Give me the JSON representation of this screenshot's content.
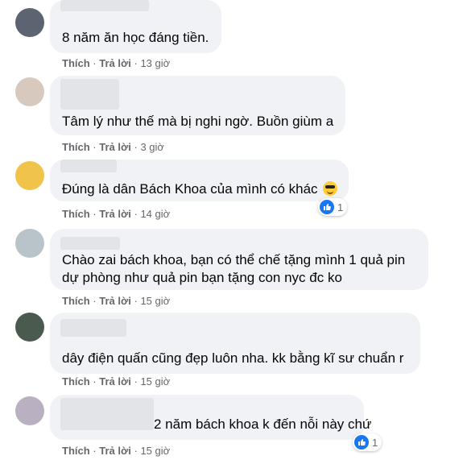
{
  "comments": [
    {
      "text_lines": [
        "8 năm ăn học đáng tiền."
      ],
      "like": "Thích",
      "reply": "Trả lời",
      "time": "13 giờ"
    },
    {
      "text_lines": [
        "Tâm lý như thế mà bị nghi ngờ. Buồn giùm a"
      ],
      "like": "Thích",
      "reply": "Trả lời",
      "time": "3 giờ"
    },
    {
      "text_lines": [
        "Đúng là dân Bách Khoa của mình có khác"
      ],
      "emoji": "sunglasses-emoji",
      "like": "Thích",
      "reply": "Trả lời",
      "time": "14 giờ",
      "reaction_count": "1"
    },
    {
      "text_lines": [
        "Chào zai bách khoa, bạn có thể chế tặng mình 1 quả pin",
        "dự phòng như quả pin bạn tặng con nyc đc ko"
      ],
      "like": "Thích",
      "reply": "Trả lời",
      "time": "15 giờ"
    },
    {
      "text_lines": [
        "dây điện quấn cũng đẹp luôn nha. kk bằng kĩ sư chuẩn r"
      ],
      "like": "Thích",
      "reply": "Trả lời",
      "time": "15 giờ"
    },
    {
      "text_lines": [
        "2 năm bách khoa k đến nỗi này chứ"
      ],
      "like": "Thích",
      "reply": "Trả lời",
      "time": "15 giờ",
      "reaction_count": "1"
    }
  ],
  "separator": "·",
  "colors": {
    "bubble": "#f0f2f5",
    "meta": "#65676b",
    "like_blue": "#1877f2"
  }
}
